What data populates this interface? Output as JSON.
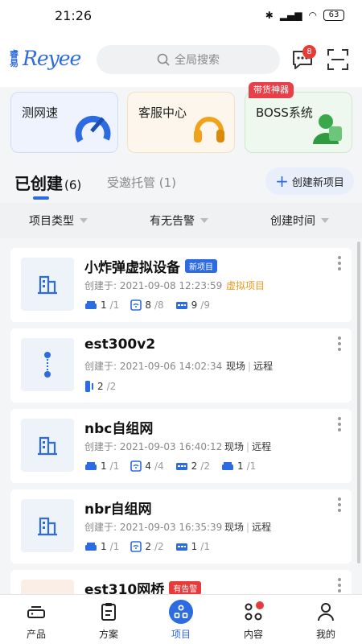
{
  "status": {
    "time": "21:26",
    "battery": "63"
  },
  "header": {
    "logo_cn": "睿易",
    "logo_en": "Reyee",
    "search_placeholder": "全局搜索",
    "message_count": "8"
  },
  "quick_actions": [
    {
      "label": "测网速"
    },
    {
      "label": "客服中心"
    },
    {
      "label": "BOSS系统",
      "promo": "带货神器"
    }
  ],
  "tabs": {
    "created_label": "已创建",
    "created_count": "(6)",
    "hosted_label": "受邀托管 (1)",
    "create_button": "创建新项目"
  },
  "filters": [
    "项目类型",
    "有无告警",
    "创建时间"
  ],
  "projects": [
    {
      "name": "小炸弹虚拟设备",
      "tag": "新项目",
      "created": "创建于: 2021-09-08 12:23:59",
      "virtual": "虚拟项目",
      "devices": [
        {
          "icon": "router-icon",
          "on": "1",
          "total": "/1"
        },
        {
          "icon": "ap-icon",
          "on": "8",
          "total": "/8"
        },
        {
          "icon": "switch-icon",
          "on": "9",
          "total": "/9"
        }
      ]
    },
    {
      "name": "est300v2",
      "created": "创建于: 2021-09-06 14:02:34",
      "mode_a": "现场",
      "mode_b": "远程",
      "devices": [
        {
          "icon": "bridge-icon",
          "on": "2",
          "total": "/2"
        }
      ]
    },
    {
      "name": "nbc自组网",
      "created": "创建于: 2021-09-03 16:40:12",
      "mode_a": "现场",
      "mode_b": "远程",
      "devices": [
        {
          "icon": "router-icon",
          "on": "1",
          "total": "/1"
        },
        {
          "icon": "ap-icon",
          "on": "4",
          "total": "/4"
        },
        {
          "icon": "switch-icon",
          "on": "2",
          "total": "/2"
        },
        {
          "icon": "router-icon",
          "on": "1",
          "total": "/1"
        }
      ]
    },
    {
      "name": "nbr自组网",
      "created": "创建于: 2021-09-03 16:35:39",
      "mode_a": "现场",
      "mode_b": "远程",
      "devices": [
        {
          "icon": "router-icon",
          "on": "1",
          "total": "/1"
        },
        {
          "icon": "ap-icon",
          "on": "2",
          "total": "/2"
        },
        {
          "icon": "switch-icon",
          "on": "1",
          "total": "/1"
        }
      ]
    },
    {
      "name": "est310网桥",
      "tag": "有告警"
    }
  ],
  "nav": [
    {
      "label": "产品"
    },
    {
      "label": "方案"
    },
    {
      "label": "项目"
    },
    {
      "label": "内容"
    },
    {
      "label": "我的"
    }
  ],
  "colors": {
    "accent": "#2d6be0",
    "alarm": "#e63b3b",
    "virtual": "#e89a1c"
  }
}
